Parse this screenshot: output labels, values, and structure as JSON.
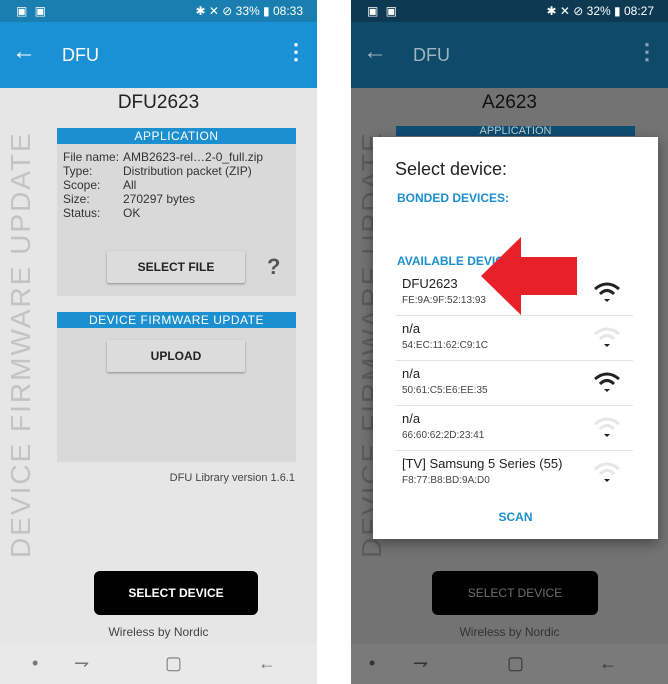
{
  "left": {
    "status": {
      "left_icons": "▣ ▣",
      "right": "✱ ✕ ⊘ 33% ▮ 08:33"
    },
    "appbar": {
      "title": "DFU",
      "back_icon": "←",
      "menu_icon": "⋮"
    },
    "device_title": "DFU2623",
    "vertical_text": "DEVICE FIRMWARE UPDATE",
    "application": {
      "header": "APPLICATION",
      "labels": {
        "file_name": "File name:",
        "type": "Type:",
        "scope": "Scope:",
        "size": "Size:",
        "status": "Status:"
      },
      "values": {
        "file_name": "AMB2623-rel…2-0_full.zip",
        "type": "Distribution packet (ZIP)",
        "scope": "All",
        "size": "270297 bytes",
        "status": "OK"
      },
      "select_file": "SELECT FILE",
      "help": "?"
    },
    "dfu": {
      "header": "DEVICE FIRMWARE UPDATE",
      "upload": "UPLOAD"
    },
    "version": "DFU Library version 1.6.1",
    "select_device": "SELECT DEVICE",
    "footer": "Wireless by Nordic",
    "nav": {
      "dot": "•",
      "recent": "⇁",
      "home": "▢",
      "back": "←"
    }
  },
  "right": {
    "status": {
      "left_icons": "▣ ▣",
      "right": "✱ ✕ ⊘ 32% ▮ 08:27"
    },
    "appbar": {
      "title": "DFU",
      "back_icon": "←",
      "menu_icon": "⋮"
    },
    "device_title": "A2623",
    "app_hint": "APPLICATION",
    "vertical_text": "DEVICE FIRMWARE UPDATE",
    "select_device": "SELECT DEVICE",
    "footer": "Wireless by Nordic",
    "dialog": {
      "title": "Select device:",
      "bonded": "BONDED DEVICES:",
      "available": "AVAILABLE DEVICES:",
      "devices": [
        {
          "name": "DFU2623",
          "mac": "FE:9A:9F:52:13:93",
          "signal": "strong"
        },
        {
          "name": "n/a",
          "mac": "54:EC:11:62:C9:1C",
          "signal": "weak"
        },
        {
          "name": "n/a",
          "mac": "50:61:C5:E6:EE:35",
          "signal": "strong"
        },
        {
          "name": "n/a",
          "mac": "66:60:62:2D:23:41",
          "signal": "weak"
        },
        {
          "name": "[TV] Samsung 5 Series (55)",
          "mac": "F8:77:B8:BD:9A:D0",
          "signal": "weak"
        }
      ],
      "scan": "SCAN"
    },
    "nav": {
      "dot": "•",
      "recent": "⇁",
      "home": "▢",
      "back": "←"
    }
  },
  "colors": {
    "accent": "#1b8fcf",
    "arrow": "#e8202a"
  }
}
